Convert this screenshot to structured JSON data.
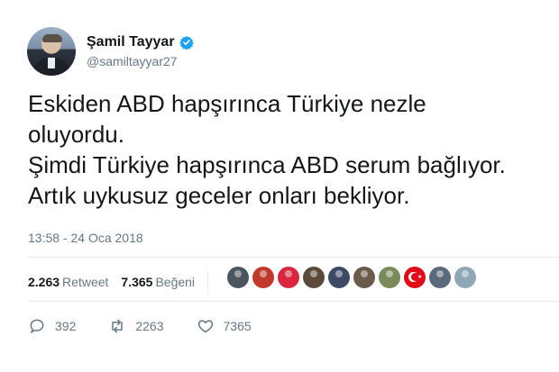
{
  "user": {
    "display_name": "Şamil Tayyar",
    "handle": "@samiltayyar27",
    "verified_icon": "verified-badge-icon"
  },
  "tweet": {
    "text": "Eskiden ABD hapşırınca Türkiye nezle\noluyordu.\nŞimdi Türkiye hapşırınca ABD serum bağlıyor.\nArtık uykusuz geceler onları bekliyor.",
    "timestamp": "13:58 - 24 Oca 2018"
  },
  "stats": {
    "retweets_count": "2.263",
    "retweets_label": "Retweet",
    "likes_count": "7.365",
    "likes_label": "Beğeni"
  },
  "likers": [
    {
      "icon": "avatar-icon",
      "color": "#4a5560"
    },
    {
      "icon": "avatar-icon",
      "color": "#c0392b"
    },
    {
      "icon": "logo-icon",
      "color": "#d7263d"
    },
    {
      "icon": "avatar-icon",
      "color": "#5b4a3a"
    },
    {
      "icon": "avatar-icon",
      "color": "#3d4a66"
    },
    {
      "icon": "avatar-icon",
      "color": "#6b5b4b"
    },
    {
      "icon": "avatar-icon",
      "color": "#7b8a5a"
    },
    {
      "icon": "turkish-flag-icon",
      "color": "#e30a17"
    },
    {
      "icon": "avatar-icon",
      "color": "#5a6a7a"
    },
    {
      "icon": "avatar-icon",
      "color": "#8fa8b8"
    }
  ],
  "actions": {
    "replies": "392",
    "retweets": "2263",
    "likes": "7365"
  },
  "colors": {
    "text": "#14171a",
    "secondary": "#657786",
    "verified": "#1da1f2",
    "divider": "#e6ecf0"
  }
}
